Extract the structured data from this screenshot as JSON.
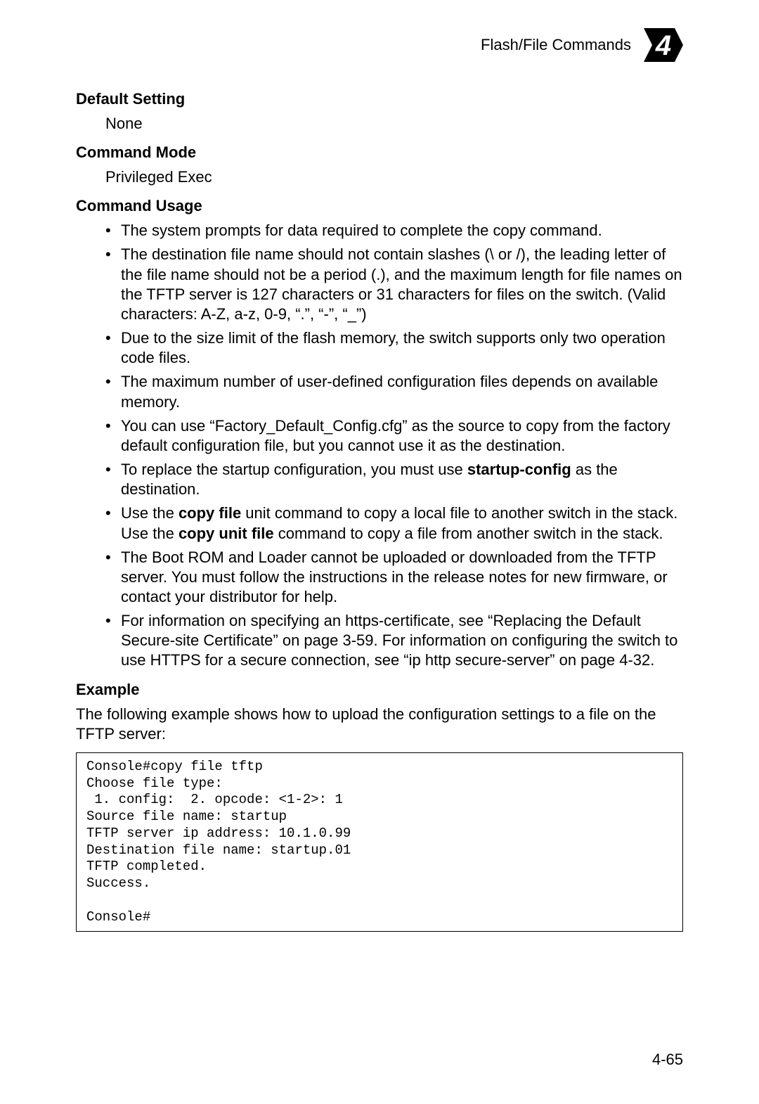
{
  "header": {
    "title": "Flash/File Commands",
    "chapter": "4"
  },
  "sections": {
    "defaultSetting": {
      "heading": "Default Setting",
      "body": "None"
    },
    "commandMode": {
      "heading": "Command Mode",
      "body": "Privileged Exec"
    },
    "commandUsage": {
      "heading": "Command Usage",
      "items": [
        {
          "pre": "The system prompts for data required to complete the copy command."
        },
        {
          "pre": "The destination file name should not contain slashes (\\ or /), the leading letter of the file name should not be a period (.), and the maximum length for file names on the TFTP server is 127 characters or 31 characters for files on the switch. (Valid characters: A-Z, a-z, 0-9, “.”, “-”, “_”)"
        },
        {
          "pre": "Due to the size limit of the flash memory, the switch supports only two operation code files."
        },
        {
          "pre": "The maximum number of user-defined configuration files depends on available memory."
        },
        {
          "pre": "You can use “Factory_Default_Config.cfg” as the source to copy from the factory default configuration file, but you cannot use it as the destination."
        },
        {
          "pre": "To replace the startup configuration, you must use ",
          "b1": "startup-config",
          "post": " as the destination."
        },
        {
          "pre": "Use the ",
          "b1": "copy file",
          "mid": " unit command to copy a local file to another switch in the stack. Use the ",
          "b2": "copy unit file",
          "post": " command to copy a file from another switch in the stack."
        },
        {
          "pre": "The Boot ROM and Loader cannot be uploaded or downloaded from the TFTP server. You must follow the instructions in the release notes for new firmware, or contact your distributor for help."
        },
        {
          "pre": "For information on specifying an https-certificate, see “Replacing the Default Secure-site Certificate” on page 3-59. For information on configuring the switch to use HTTPS for a secure connection, see “ip http secure-server” on page 4-32."
        }
      ]
    },
    "example": {
      "heading": "Example",
      "intro": "The following example shows how to upload the configuration settings to a file on the TFTP server:",
      "console": "Console#copy file tftp\nChoose file type:\n 1. config:  2. opcode: <1-2>: 1\nSource file name: startup\nTFTP server ip address: 10.1.0.99\nDestination file name: startup.01\nTFTP completed.\nSuccess.\n\nConsole#"
    }
  },
  "pageNumber": "4-65"
}
